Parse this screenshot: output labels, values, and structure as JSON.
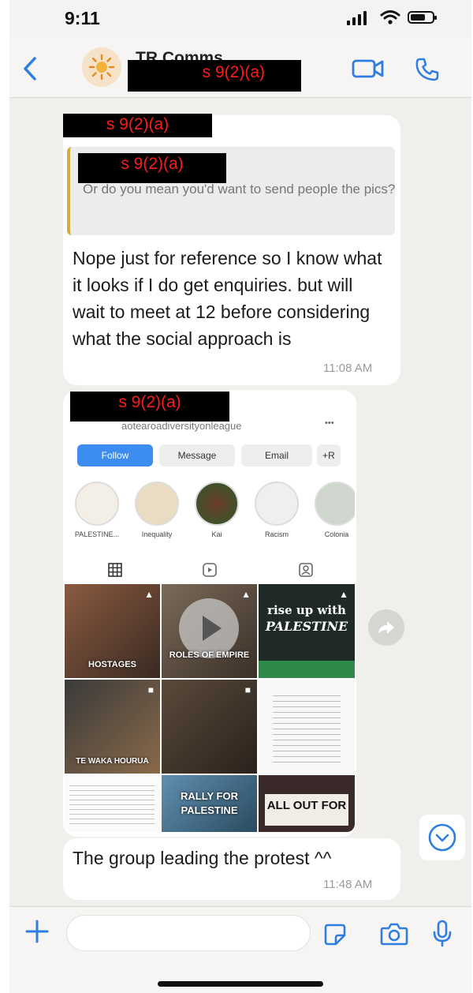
{
  "status_bar": {
    "time": "9:11"
  },
  "header": {
    "contact_name": "TR Comms",
    "redaction_label": "s 9(2)(a)"
  },
  "messages": [
    {
      "sender_redaction": "s 9(2)(a)",
      "quote_author_redaction": "s 9(2)(a)",
      "quote_text": "Or do you mean you'd want to send people the pics?",
      "text": "Nope just for reference so I know what it looks if I do get enquiries. but will wait to meet at 12 before considering what the social approach is",
      "time": "11:08 AM"
    },
    {
      "sender_redaction": "s 9(2)(a)",
      "caption": "The group leading the protest ^^",
      "time": "11:48 AM"
    }
  ],
  "instagram": {
    "handle": "aotearoadiversityonleague",
    "more": "•••",
    "buttons": {
      "follow": "Follow",
      "message": "Message",
      "email": "Email",
      "add": "+R"
    },
    "highlights": [
      "PALESTINE...",
      "Inequality",
      "Kai",
      "Racism",
      "Colonia"
    ],
    "tiles": {
      "t1": "HOSTAGES",
      "t2": "ROLES OF EMPIRE",
      "t3_line1": "rise up with",
      "t3_line2": "PALESTINE",
      "t5": "TE WAKA HOURUA",
      "t8": "RALLY FOR PALESTINE",
      "t9": "ALL OUT FOR"
    }
  }
}
